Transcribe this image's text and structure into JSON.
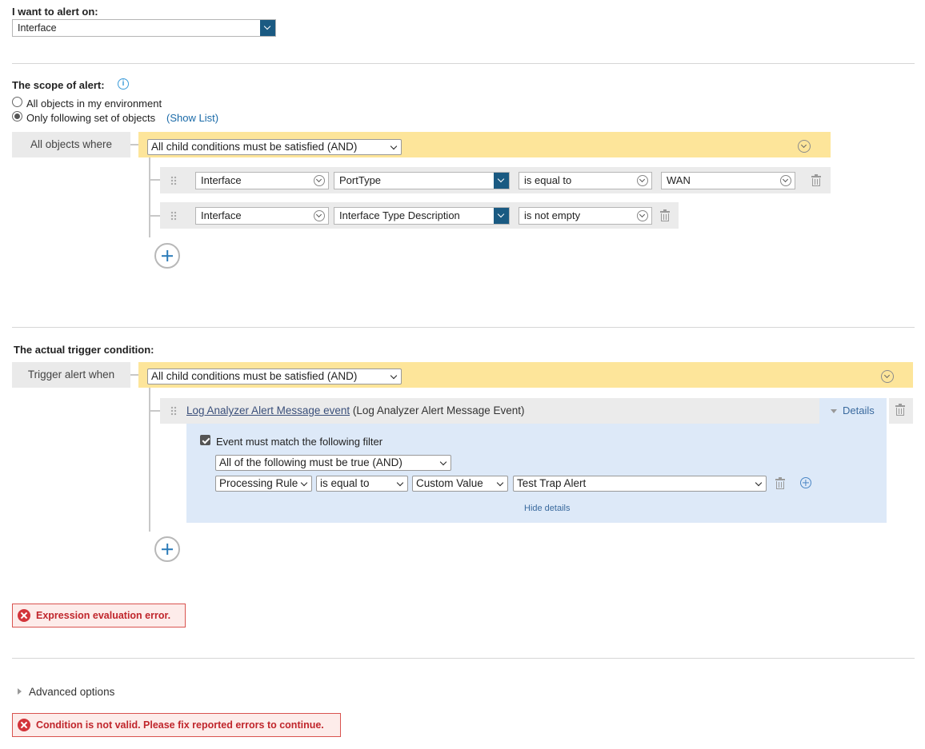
{
  "alert_on": {
    "label": "I want to alert on:",
    "value": "Interface"
  },
  "scope": {
    "label": "The scope of alert:",
    "option_all": "All objects in my environment",
    "option_following": "Only following set of objects",
    "show_list": "(Show List)",
    "selected": "following",
    "group_label": "All objects where",
    "group_operator": "All child conditions must be satisfied (AND)",
    "conditions": [
      {
        "object": "Interface",
        "field": "PortType",
        "operator": "is equal to",
        "value": "WAN"
      },
      {
        "object": "Interface",
        "field": "Interface Type Description",
        "operator": "is not empty"
      }
    ]
  },
  "trigger": {
    "label": "The actual trigger condition:",
    "group_label": "Trigger alert when",
    "group_operator": "All child conditions must be satisfied (AND)",
    "event_link": "Log Analyzer Alert Message event",
    "event_suffix": "(Log Analyzer Alert Message Event)",
    "details_label": "Details",
    "filter_checkbox_label": "Event must match the following filter",
    "filter_checked": true,
    "filter_operator": "All of the following must be true (AND)",
    "filter_row": {
      "field": "Processing Rule",
      "operator": "is equal to",
      "value_type": "Custom Value",
      "value": "Test Trap Alert"
    },
    "hide_details": "Hide details"
  },
  "errors": {
    "expression": "Expression evaluation error.",
    "condition": "Condition is not valid. Please fix reported errors to continue."
  },
  "advanced_options": "Advanced options",
  "colors": {
    "yellow_bar": "#fde59a",
    "accent_blue": "#1a5a82",
    "error_red": "#c0262c",
    "filter_bg": "#dde9f8"
  }
}
